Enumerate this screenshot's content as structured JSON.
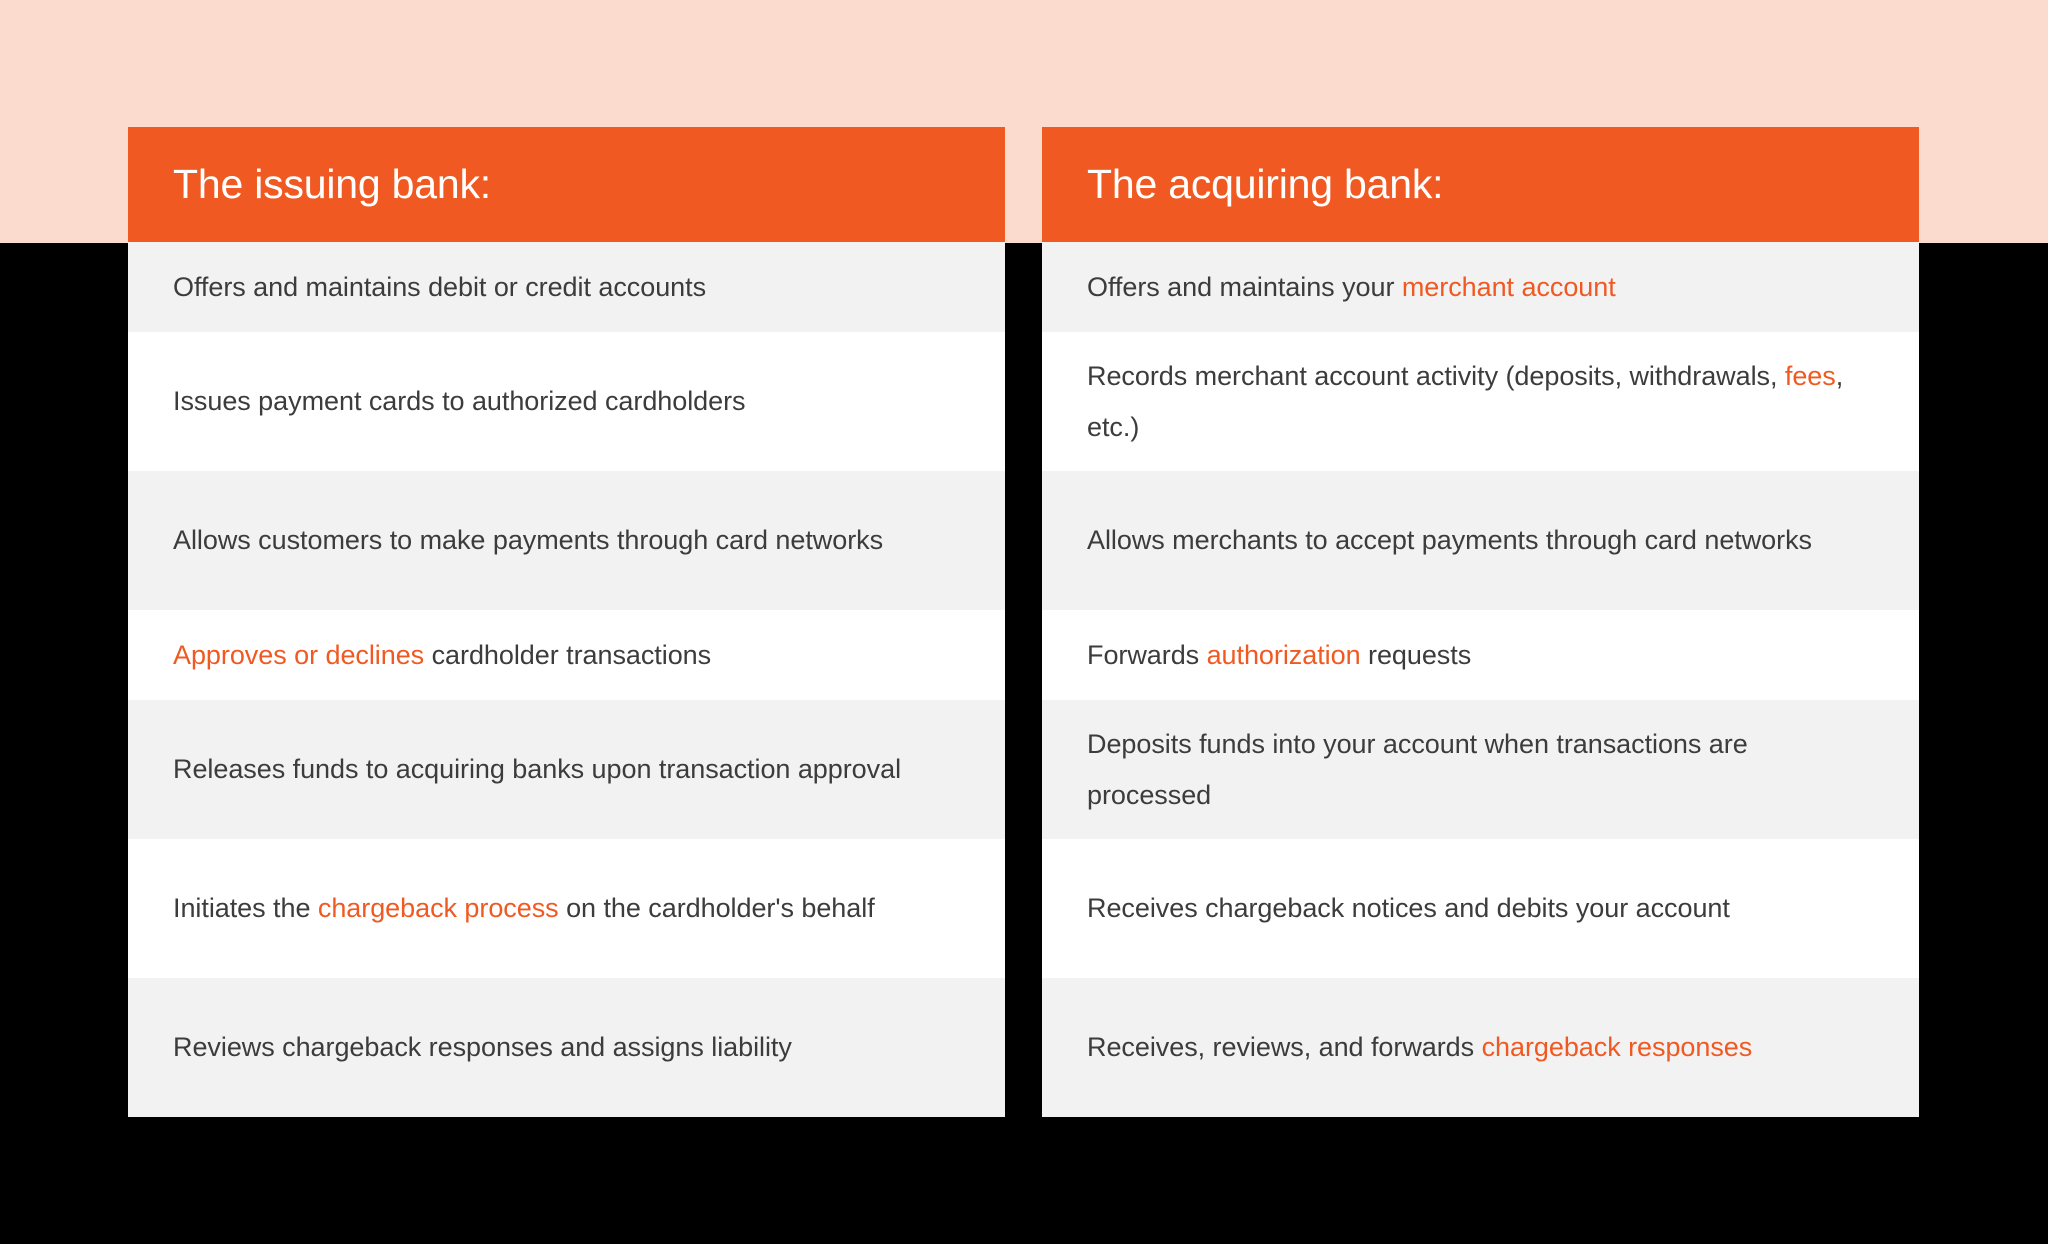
{
  "theme": {
    "accent_orange": "#F05A22",
    "band_peach": "#FADBCE",
    "row_gray": "#F2F2F2",
    "row_white": "#FFFFFF",
    "text_dark": "#3C3C3C",
    "page_black": "#000000"
  },
  "columns": [
    {
      "id": "issuing-bank",
      "title": "The issuing bank:",
      "rows": [
        {
          "shade": "gray",
          "lines": 1,
          "plain": "Offers and maintains debit or credit accounts",
          "segments": [
            {
              "text": "Offers and maintains debit or credit accounts",
              "highlight": false
            }
          ]
        },
        {
          "shade": "white",
          "lines": 2,
          "plain": "Issues payment cards to authorized cardholders",
          "segments": [
            {
              "text": "Issues payment cards to authorized cardholders",
              "highlight": false
            }
          ]
        },
        {
          "shade": "gray",
          "lines": 2,
          "plain": "Allows customers to make payments through card networks",
          "segments": [
            {
              "text": "Allows customers to make payments through card networks",
              "highlight": false
            }
          ]
        },
        {
          "shade": "white",
          "lines": 1,
          "plain": "Approves or declines cardholder transactions",
          "segments": [
            {
              "text": "Approves or declines",
              "highlight": true
            },
            {
              "text": " cardholder transactions",
              "highlight": false
            }
          ]
        },
        {
          "shade": "gray",
          "lines": 2,
          "plain": "Releases funds to acquiring banks upon transaction approval",
          "segments": [
            {
              "text": "Releases funds to acquiring banks upon transaction approval",
              "highlight": false
            }
          ]
        },
        {
          "shade": "white",
          "lines": 2,
          "plain": "Initiates the chargeback process on the cardholder's behalf",
          "segments": [
            {
              "text": "Initiates the ",
              "highlight": false
            },
            {
              "text": "chargeback process",
              "highlight": true
            },
            {
              "text": " on the cardholder's behalf",
              "highlight": false
            }
          ]
        },
        {
          "shade": "gray",
          "lines": 2,
          "plain": "Reviews chargeback responses and assigns liability",
          "segments": [
            {
              "text": "Reviews chargeback responses and assigns liability",
              "highlight": false
            }
          ]
        }
      ]
    },
    {
      "id": "acquiring-bank",
      "title": "The acquiring bank:",
      "rows": [
        {
          "shade": "gray",
          "lines": 1,
          "plain": "Offers and maintains your merchant account",
          "segments": [
            {
              "text": "Offers and maintains your ",
              "highlight": false
            },
            {
              "text": "merchant account",
              "highlight": true
            }
          ]
        },
        {
          "shade": "white",
          "lines": 2,
          "plain": "Records merchant account activity (deposits, withdrawals, fees, etc.)",
          "segments": [
            {
              "text": "Records merchant account activity (deposits, withdrawals, ",
              "highlight": false
            },
            {
              "text": "fees",
              "highlight": true
            },
            {
              "text": ", etc.)",
              "highlight": false
            }
          ]
        },
        {
          "shade": "gray",
          "lines": 2,
          "plain": "Allows merchants to accept payments through card networks",
          "segments": [
            {
              "text": "Allows merchants to accept payments through card networks",
              "highlight": false
            }
          ]
        },
        {
          "shade": "white",
          "lines": 1,
          "plain": "Forwards authorization requests",
          "segments": [
            {
              "text": "Forwards ",
              "highlight": false
            },
            {
              "text": "authorization",
              "highlight": true
            },
            {
              "text": " requests",
              "highlight": false
            }
          ]
        },
        {
          "shade": "gray",
          "lines": 2,
          "plain": "Deposits funds into your account when transactions are processed",
          "segments": [
            {
              "text": "Deposits funds into your account when transactions are processed",
              "highlight": false
            }
          ]
        },
        {
          "shade": "white",
          "lines": 2,
          "plain": "Receives chargeback notices and debits your account",
          "segments": [
            {
              "text": "Receives chargeback notices and debits your account",
              "highlight": false
            }
          ]
        },
        {
          "shade": "gray",
          "lines": 2,
          "plain": "Receives, reviews, and forwards chargeback responses",
          "segments": [
            {
              "text": "Receives, reviews, and forwards ",
              "highlight": false
            },
            {
              "text": "chargeback responses",
              "highlight": true
            }
          ]
        }
      ]
    }
  ]
}
